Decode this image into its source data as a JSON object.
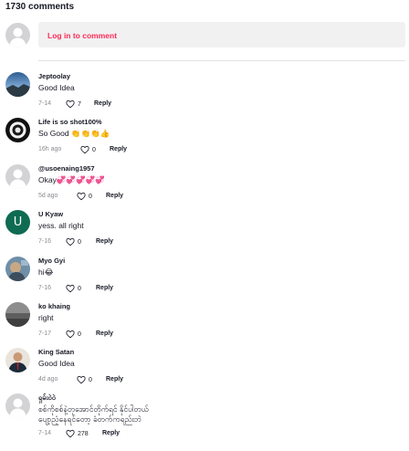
{
  "header": {
    "comments_count": "1730 comments"
  },
  "login": {
    "link": "Log in to comment"
  },
  "comments": [
    {
      "username": "Jeptoolay",
      "text": "Good Idea",
      "date": "7-14",
      "likes": "7",
      "reply": "Reply"
    },
    {
      "username": "Life is so shot100%",
      "text": "So Good 👏👏👏👍",
      "date": "16h ago",
      "likes": "0",
      "reply": "Reply"
    },
    {
      "username": "@usoenaing1957",
      "text": "Okay💞💞💞💞💞",
      "date": "5d ago",
      "likes": "0",
      "reply": "Reply"
    },
    {
      "username": "U Kyaw",
      "avatar_letter": "U",
      "text": "yess. all right",
      "date": "7-16",
      "likes": "0",
      "reply": "Reply"
    },
    {
      "username": "Myo Gyi",
      "text": "hi😂",
      "date": "7-16",
      "likes": "0",
      "reply": "Reply"
    },
    {
      "username": "ko khaing",
      "text": "right",
      "date": "7-17",
      "likes": "0",
      "reply": "Reply"
    },
    {
      "username": "King Satan",
      "text": "Good Idea",
      "date": "4d ago",
      "likes": "0",
      "reply": "Reply"
    },
    {
      "username": "ရှမ်းဝဲဝဲ",
      "text_line1": "စစ်ကိုစစ်နဲ့တုအောင်တိုက်ရင် နိုင်ပါတယ်",
      "text_line2": "ပျော့ညံ့နေရင်တော့ ခံတက်ကရည်းဘဲ",
      "date": "7-14",
      "likes": "278",
      "reply": "Reply"
    }
  ],
  "colors": {
    "accent": "#fe2c55",
    "text": "#161823",
    "muted": "#8a8b91",
    "u_avatar": "#0f6b52"
  }
}
